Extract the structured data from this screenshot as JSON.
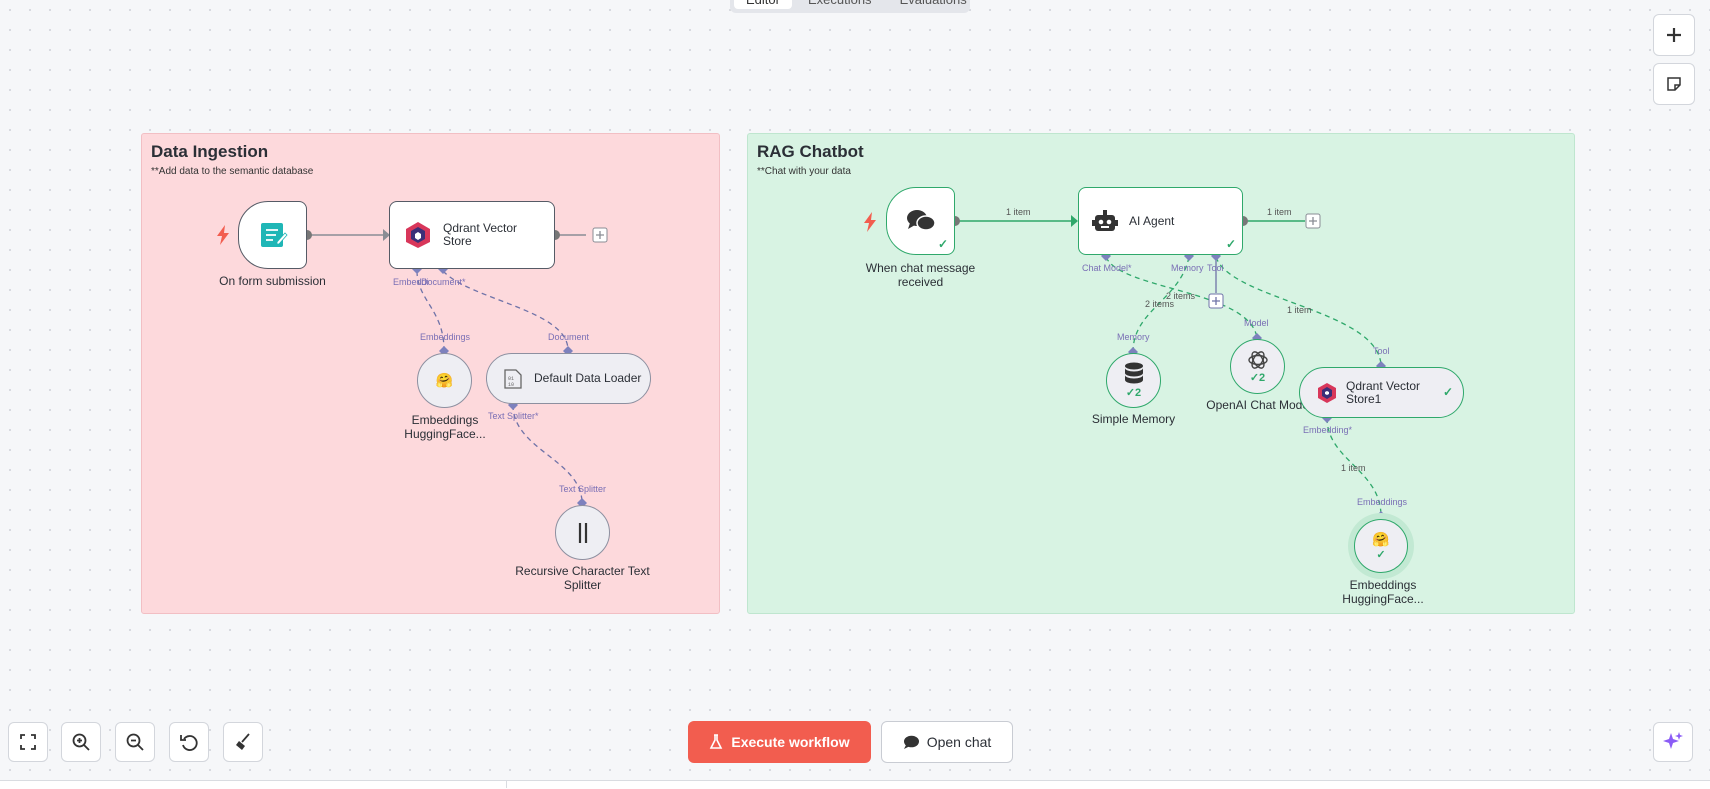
{
  "tabs": [
    "Editor",
    "Executions",
    "Evaluations"
  ],
  "sticky_ingestion": {
    "title": "Data Ingestion",
    "subtitle": "**Add data to the semantic database"
  },
  "sticky_chatbot": {
    "title": "RAG Chatbot",
    "subtitle": "**Chat with your data"
  },
  "nodes": {
    "form_trigger": {
      "caption": "On form submission"
    },
    "qdrant_store": {
      "label": "Qdrant Vector Store",
      "ports": [
        "Embeddi",
        "Document*"
      ]
    },
    "embeddings_hf": {
      "caption": "Embeddings HuggingFace...",
      "port": "Embeddings"
    },
    "default_loader": {
      "label": "Default Data Loader",
      "port": "Document",
      "out_port": "Text Splitter*"
    },
    "text_splitter": {
      "caption": "Recursive Character Text Splitter",
      "port": "Text Splitter"
    },
    "chat_trigger": {
      "caption": "When chat message received"
    },
    "ai_agent": {
      "label": "AI Agent",
      "ports": [
        "Chat Model*",
        "Memory",
        "Tool"
      ]
    },
    "simple_memory": {
      "caption": "Simple Memory",
      "port": "Memory",
      "count": "2"
    },
    "openai_model": {
      "caption": "OpenAI Chat Model",
      "port": "Model",
      "count": "2"
    },
    "qdrant_store1": {
      "label": "Qdrant Vector Store1",
      "port": "Tool",
      "out_port": "Embedding*"
    },
    "embeddings_hf1": {
      "caption": "Embeddings HuggingFace...",
      "port": "Embeddings"
    }
  },
  "edge_labels": {
    "chat_to_agent": "1 item",
    "agent_out": "1 item",
    "memory": "2 items",
    "model": "2 items",
    "tool": "1 item",
    "embedding": "1 item"
  },
  "toolbar": {
    "execute_label": "Execute workflow",
    "open_chat_label": "Open chat"
  },
  "colors": {
    "accent": "#f25d4f",
    "success": "#2fa86b",
    "port": "#7a6fb5",
    "ingestion_bg": "#fdd9dc",
    "chatbot_bg": "#d8f3e3"
  }
}
